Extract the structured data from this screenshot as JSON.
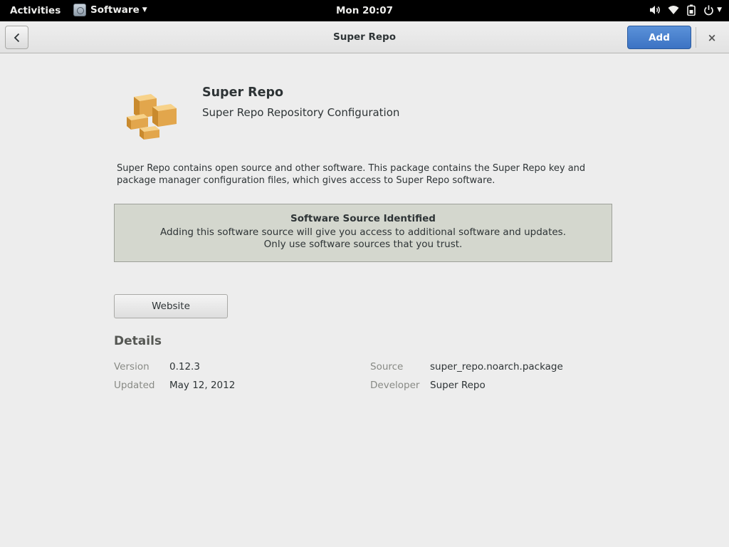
{
  "topbar": {
    "activities": "Activities",
    "app_menu": "Software",
    "clock": "Mon 20:07",
    "tray_icons": [
      "volume-icon",
      "wifi-icon",
      "battery-icon",
      "power-icon"
    ]
  },
  "header": {
    "title": "Super Repo",
    "add_label": "Add",
    "close_label": "×"
  },
  "app": {
    "name": "Super Repo",
    "summary": "Super Repo Repository Configuration",
    "icon": "package-boxes-icon",
    "description": "Super Repo contains open source and other software. This package contains the Super Repo key and package manager configuration files, which gives access to Super Repo software."
  },
  "infobar": {
    "title": "Software Source Identified",
    "line1": "Adding this software source will give you access to additional software and updates.",
    "line2": "Only use software sources that you trust."
  },
  "buttons": {
    "website": "Website"
  },
  "details": {
    "heading": "Details",
    "version_label": "Version",
    "version_value": "0.12.3",
    "updated_label": "Updated",
    "updated_value": "May 12, 2012",
    "source_label": "Source",
    "source_value": "super_repo.noarch.package",
    "developer_label": "Developer",
    "developer_value": "Super Repo"
  },
  "colors": {
    "accent": "#4a86d4",
    "infobar_bg": "#d4d7ce",
    "topbar_bg": "#000000",
    "content_bg": "#ededed"
  }
}
